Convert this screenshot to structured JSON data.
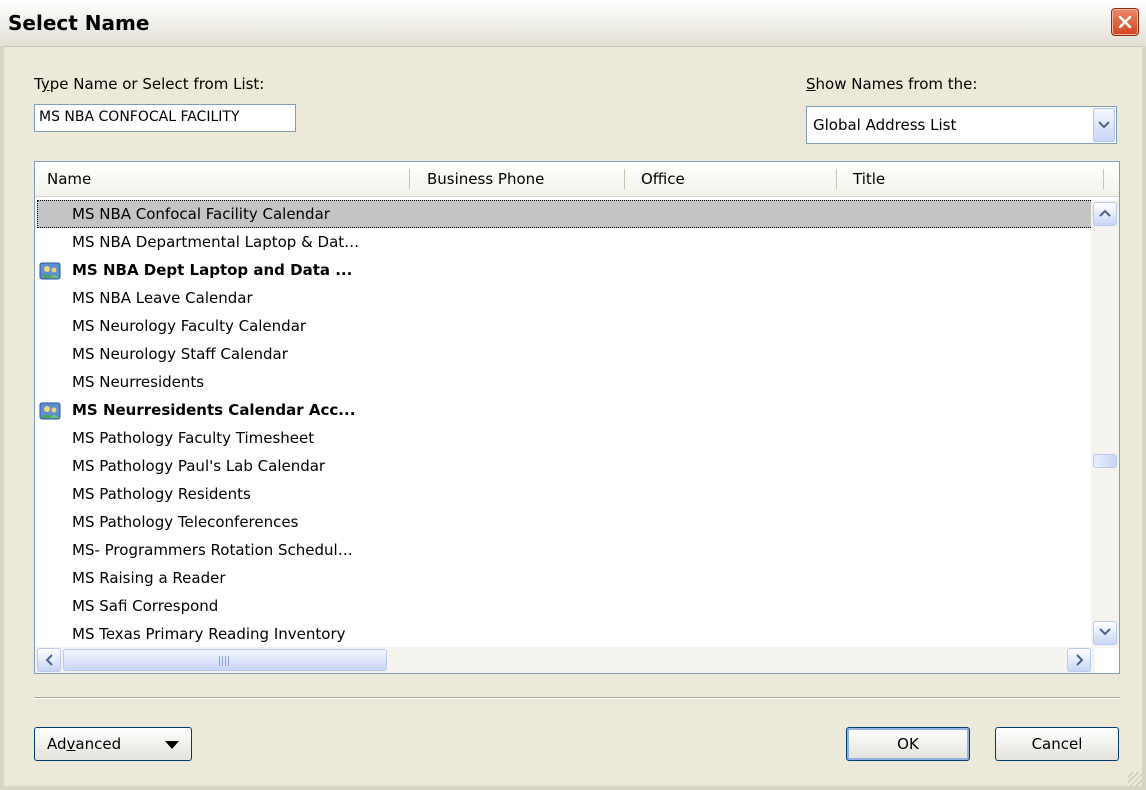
{
  "window": {
    "title": "Select Name"
  },
  "search": {
    "label_pre": "T",
    "label_accel": "y",
    "label_post": "pe Name or Select from List:",
    "value": "MS NBA CONFOCAL FACILITY"
  },
  "source": {
    "label_accel": "S",
    "label_post": "how Names from the:",
    "value": "Global Address List"
  },
  "columns": [
    "Name",
    "Business Phone",
    "Office",
    "Title"
  ],
  "rows": [
    {
      "name": "MS NBA Confocal Facility Calendar",
      "bold": false,
      "icon": false,
      "selected": true
    },
    {
      "name": "MS NBA Departmental Laptop & Dat…",
      "bold": false,
      "icon": false,
      "selected": false
    },
    {
      "name": "MS NBA Dept Laptop and Data ...",
      "bold": true,
      "icon": "distribution-list-icon",
      "selected": false
    },
    {
      "name": "MS NBA Leave Calendar",
      "bold": false,
      "icon": false,
      "selected": false
    },
    {
      "name": "MS Neurology Faculty Calendar",
      "bold": false,
      "icon": false,
      "selected": false
    },
    {
      "name": "MS Neurology Staff Calendar",
      "bold": false,
      "icon": false,
      "selected": false
    },
    {
      "name": "MS Neurresidents",
      "bold": false,
      "icon": false,
      "selected": false
    },
    {
      "name": "MS Neurresidents Calendar Acc...",
      "bold": true,
      "icon": "distribution-list-icon",
      "selected": false
    },
    {
      "name": "MS Pathology Faculty Timesheet",
      "bold": false,
      "icon": false,
      "selected": false
    },
    {
      "name": "MS Pathology Paul's Lab Calendar",
      "bold": false,
      "icon": false,
      "selected": false
    },
    {
      "name": "MS Pathology Residents",
      "bold": false,
      "icon": false,
      "selected": false
    },
    {
      "name": "MS Pathology Teleconferences",
      "bold": false,
      "icon": false,
      "selected": false
    },
    {
      "name": "MS- Programmers Rotation Schedul…",
      "bold": false,
      "icon": false,
      "selected": false
    },
    {
      "name": "MS Raising a Reader",
      "bold": false,
      "icon": false,
      "selected": false
    },
    {
      "name": "MS Safi Correspond",
      "bold": false,
      "icon": false,
      "selected": false
    },
    {
      "name": "MS Texas Primary Reading Inventory",
      "bold": false,
      "icon": false,
      "selected": false
    }
  ],
  "buttons": {
    "advanced_pre": "Ad",
    "advanced_accel": "v",
    "advanced_post": "anced",
    "ok": "OK",
    "cancel": "Cancel"
  },
  "colors": {
    "selection": "#c4c4c4",
    "close": "#d2441e",
    "dialog_bg": "#ece9d8"
  }
}
